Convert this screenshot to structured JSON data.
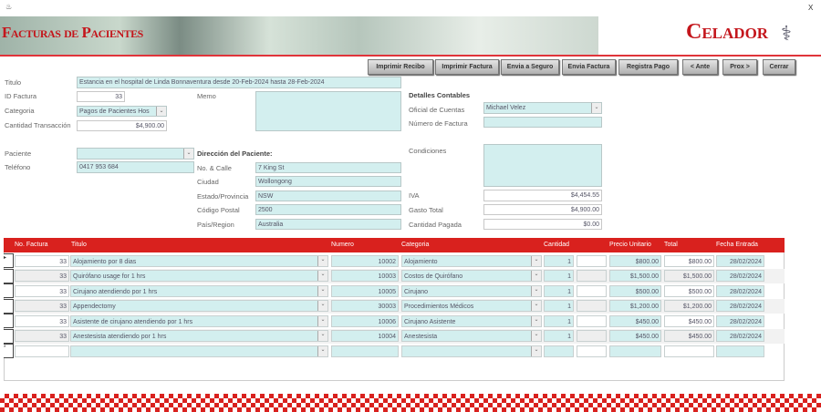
{
  "window": {
    "icon": "app-icon",
    "close": "X"
  },
  "header": {
    "title": "Facturas de Pacientes",
    "logo": "Celador",
    "accent": "#d9211e"
  },
  "toolbar": [
    "Imprimir Recibo",
    "Imprimir Factura",
    "Envia a Seguro",
    "Envia Factura",
    "Registra Pago",
    "< Ante",
    "Prox >",
    "Cerrar"
  ],
  "form": {
    "titulo_label": "Titulo",
    "titulo": "Estancia en el hospital de Linda Bonnaventura desde 20-Feb-2024 hasta 28-Feb-2024",
    "id_label": "ID Factura",
    "id": "33",
    "memo_label": "Memo",
    "memo": "",
    "categoria_label": "Categoria",
    "categoria": "Pagos de Pacientes Hos",
    "cantidad_label": "Cantidad Transacción",
    "cantidad": "$4,900.00",
    "paciente_label": "Paciente",
    "paciente": "",
    "telefono_label": "Teléfono",
    "telefono": "0417 953 684",
    "direccion_heading": "Dirección del Paciente:",
    "calle_label": "No. & Calle",
    "calle": "7 King St",
    "ciudad_label": "Ciudad",
    "ciudad": "Wollongong",
    "estado_label": "Estado/Provincia",
    "estado": "NSW",
    "cp_label": "Código Postal",
    "cp": "2500",
    "pais_label": "País/Region",
    "pais": "Australia",
    "contables_heading": "Detalles Contables",
    "oficial_label": "Oficial de Cuentas",
    "oficial": "Michael Velez",
    "numfact_label": "Número de Factura",
    "numfact": "",
    "condiciones_label": "Condiciones",
    "condiciones": "",
    "iva_label": "IVA",
    "iva": "$4,454.55",
    "gasto_label": "Gasto Total",
    "gasto": "$4,900.00",
    "pagada_label": "Cantidad Pagada",
    "pagada": "$0.00"
  },
  "grid": {
    "headers": [
      "No. Factura",
      "Titulo",
      "Numero",
      "Categoria",
      "Cantidad",
      "Precio Unitario",
      "Total",
      "Fecha Entrada"
    ],
    "rows": [
      {
        "factura": "33",
        "titulo": "Alojamiento por 8 dias",
        "numero": "10002",
        "categoria": "Alojamiento",
        "cantidad": "1",
        "precio": "$800.00",
        "total": "$800.00",
        "fecha": "28/02/2024"
      },
      {
        "factura": "33",
        "titulo": "Quirófano usage for 1 hrs",
        "numero": "10003",
        "categoria": "Costos de Quirófano",
        "cantidad": "1",
        "precio": "$1,500.00",
        "total": "$1,500.00",
        "fecha": "28/02/2024"
      },
      {
        "factura": "33",
        "titulo": "Cirujano atendiendo por 1 hrs",
        "numero": "10005",
        "categoria": "Cirujano",
        "cantidad": "1",
        "precio": "$500.00",
        "total": "$500.00",
        "fecha": "28/02/2024"
      },
      {
        "factura": "33",
        "titulo": "Appendectomy",
        "numero": "30003",
        "categoria": "Procedimientos Médicos",
        "cantidad": "1",
        "precio": "$1,200.00",
        "total": "$1,200.00",
        "fecha": "28/02/2024"
      },
      {
        "factura": "33",
        "titulo": "Asistente de cirujano atendiendo por 1 hrs",
        "numero": "10006",
        "categoria": "Cirujano Asistente",
        "cantidad": "1",
        "precio": "$450.00",
        "total": "$450.00",
        "fecha": "28/02/2024"
      },
      {
        "factura": "33",
        "titulo": "Anestesista atendiendo por 1 hrs",
        "numero": "10004",
        "categoria": "Anestesista",
        "cantidad": "1",
        "precio": "$450.00",
        "total": "$450.00",
        "fecha": "28/02/2024"
      }
    ]
  }
}
